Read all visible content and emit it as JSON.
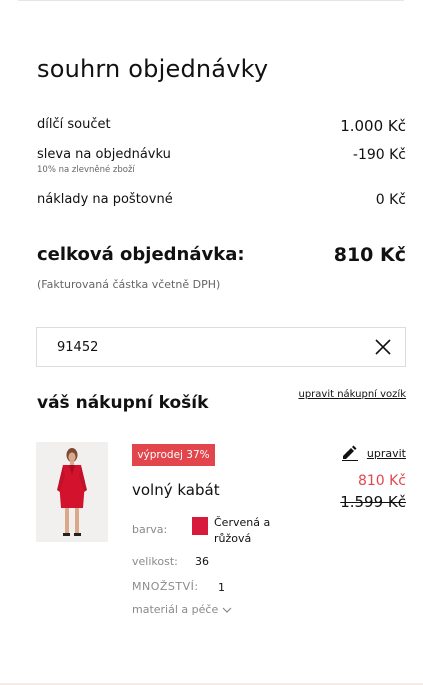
{
  "summary": {
    "title": "souhrn objednávky",
    "subtotal_label": "dílčí součet",
    "subtotal_value": "1.000 Kč",
    "discount_label": "sleva na objednávku",
    "discount_note": "10% na zlevněné zboží",
    "discount_value": "-190 Kč",
    "shipping_label": "náklady na poštovné",
    "shipping_value": "0 Kč",
    "total_label": "celková objednávka:",
    "total_value": "810 Kč",
    "total_note": "(Fakturovaná částka včetně DPH)"
  },
  "coupon": {
    "value": "91452"
  },
  "cart": {
    "title": "váš nákupní košík",
    "edit_cart_label": "upravit nákupní vozík",
    "item": {
      "badge": "výprodej 37%",
      "edit_label": "upravit",
      "name": "volný kabát",
      "price_now": "810 Kč",
      "price_old": "1.599 Kč",
      "color_label": "barva:",
      "color_value": "Červená a růžová",
      "swatch_color": "#d81b3c",
      "size_label": "velikost:",
      "size_value": "36",
      "qty_label": "MNOŽSTVÍ:",
      "qty_value": "1",
      "care_label": "materiál a péče"
    }
  },
  "colors": {
    "accent": "#e2464c",
    "text": "#111111",
    "muted": "#8a8a8a"
  }
}
